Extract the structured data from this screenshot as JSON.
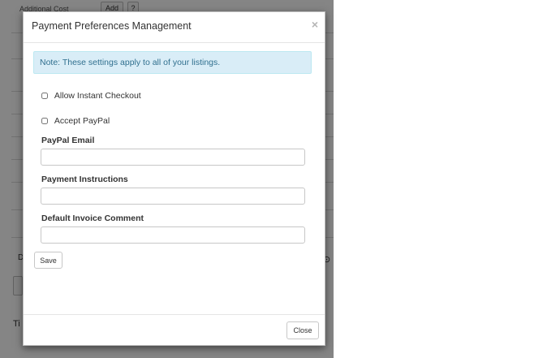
{
  "background": {
    "header_cell": "Additional Cost",
    "add_label": "Add",
    "help_label": "?",
    "side_letter_1": "D",
    "side_letter_2": "Ti"
  },
  "modal": {
    "title": "Payment Preferences Management",
    "close_icon": "×",
    "note": "Note: These settings apply to all of your listings.",
    "checkboxes": [
      {
        "label": "Allow Instant Checkout",
        "checked": false
      },
      {
        "label": "Accept PayPal",
        "checked": false
      }
    ],
    "fields": [
      {
        "label": "PayPal Email",
        "value": "",
        "placeholder": ""
      },
      {
        "label": "Payment Instructions",
        "value": "",
        "placeholder": ""
      },
      {
        "label": "Default Invoice Comment",
        "value": "",
        "placeholder": ""
      }
    ],
    "save_label": "Save",
    "close_label": "Close"
  }
}
